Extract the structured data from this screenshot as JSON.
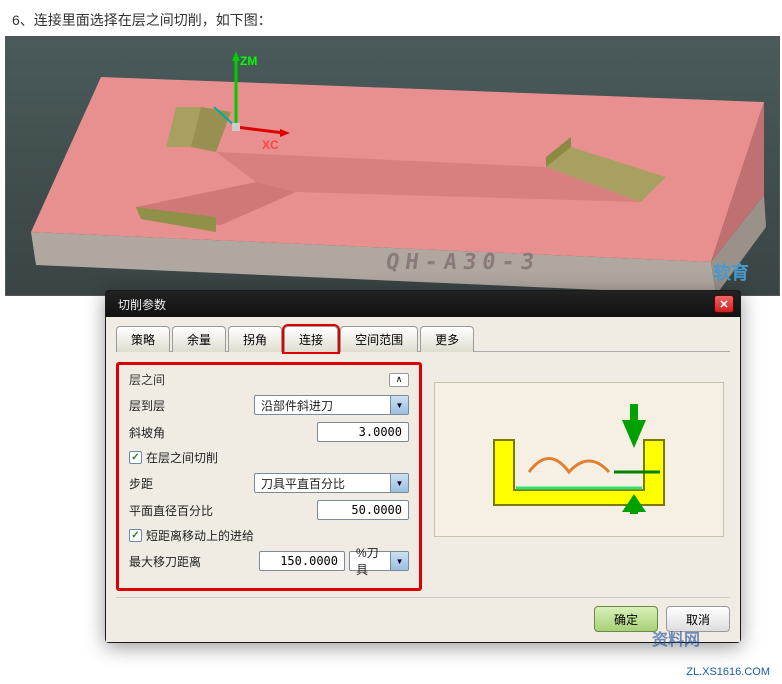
{
  "instruction_text": "6、连接里面选择在层之间切削，如下图：",
  "model_engraving": "QH-A30-3",
  "axis": {
    "x": "XC",
    "z": "ZM"
  },
  "viewport_watermark": "软育",
  "dialog": {
    "title": "切削参数",
    "tabs": [
      "策略",
      "余量",
      "拐角",
      "连接",
      "空间范围",
      "更多"
    ],
    "active_tab": "连接",
    "fieldset_title": "层之间",
    "fields": {
      "layer_to_layer": {
        "label": "层到层",
        "value": "沿部件斜进刀"
      },
      "ramp_angle": {
        "label": "斜坡角",
        "value": "3.0000"
      },
      "cut_between": {
        "label": "在层之间切削",
        "checked": true
      },
      "stepover": {
        "label": "步距",
        "value": "刀具平直百分比"
      },
      "flat_diameter_pct": {
        "label": "平面直径百分比",
        "value": "50.0000"
      },
      "short_feed": {
        "label": "短距离移动上的进给",
        "checked": true
      },
      "max_feed_distance": {
        "label": "最大移刀距离",
        "value": "150.0000",
        "unit": "%刀具"
      }
    },
    "buttons": {
      "ok": "确定",
      "cancel": "取消"
    }
  },
  "watermark": {
    "badge_line1": "资料网",
    "url": "ZL.XS1616.COM"
  }
}
